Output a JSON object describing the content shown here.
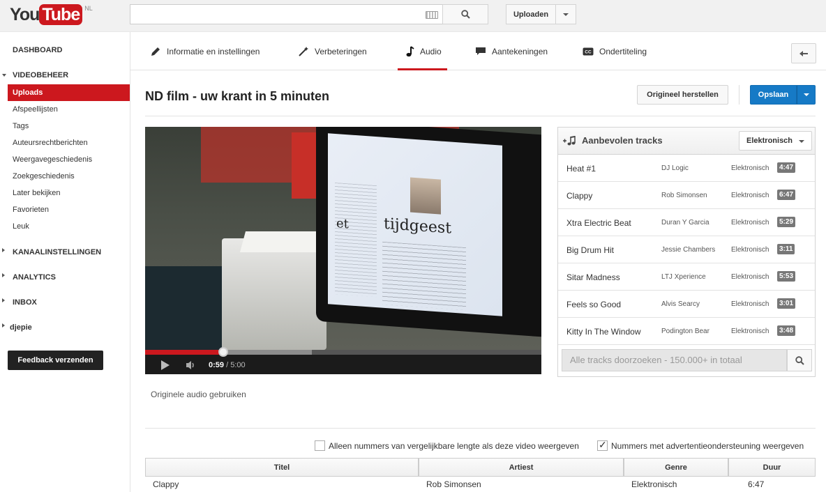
{
  "header": {
    "logo_you": "You",
    "logo_tube": "Tube",
    "logo_region": "NL",
    "search_placeholder": "",
    "upload_label": "Uploaden"
  },
  "sidebar": {
    "dashboard": "DASHBOARD",
    "videobeheer": "VIDEOBEHEER",
    "items": [
      "Uploads",
      "Afspeellijsten",
      "Tags",
      "Auteursrechtberichten",
      "Weergavegeschiedenis",
      "Zoekgeschiedenis",
      "Later bekijken",
      "Favorieten",
      "Leuk"
    ],
    "kanaal": "KANAALINSTELLINGEN",
    "analytics": "ANALYTICS",
    "inbox": "INBOX",
    "user": "djepie",
    "feedback": "Feedback verzenden"
  },
  "tabs": [
    {
      "label": "Informatie en instellingen",
      "icon": "pencil-icon"
    },
    {
      "label": "Verbeteringen",
      "icon": "magic-wand-icon"
    },
    {
      "label": "Audio",
      "icon": "music-note-icon"
    },
    {
      "label": "Aantekeningen",
      "icon": "speech-bubble-icon"
    },
    {
      "label": "Ondertiteling",
      "icon": "cc-icon"
    }
  ],
  "active_tab": "Audio",
  "editor": {
    "title": "ND film - uw krant in 5 minuten",
    "reset_label": "Origineel herstellen",
    "save_label": "Opslaan"
  },
  "video": {
    "current_time": "0:59",
    "duration": "5:00",
    "progress": 0.197,
    "buffered": 0.42,
    "screen_text": "tijdgeest",
    "screen_text2": "et"
  },
  "original_audio_label": "Originele audio gebruiken",
  "tracks_panel": {
    "title": "Aanbevolen tracks",
    "genre_selected": "Elektronisch",
    "search_placeholder": "Alle tracks doorzoeken - 150.000+ in totaal",
    "tracks": [
      {
        "title": "Heat #1",
        "artist": "DJ Logic",
        "genre": "Elektronisch",
        "duration": "4:47"
      },
      {
        "title": "Clappy",
        "artist": "Rob Simonsen",
        "genre": "Elektronisch",
        "duration": "6:47"
      },
      {
        "title": "Xtra Electric Beat",
        "artist": "Duran Y Garcia",
        "genre": "Elektronisch",
        "duration": "5:29"
      },
      {
        "title": "Big Drum Hit",
        "artist": "Jessie Chambers",
        "genre": "Elektronisch",
        "duration": "3:11"
      },
      {
        "title": "Sitar Madness",
        "artist": "LTJ Xperience",
        "genre": "Elektronisch",
        "duration": "5:53"
      },
      {
        "title": "Feels so Good",
        "artist": "Alvis Searcy",
        "genre": "Elektronisch",
        "duration": "3:01"
      },
      {
        "title": "Kitty In The Window",
        "artist": "Podington Bear",
        "genre": "Elektronisch",
        "duration": "3:48"
      }
    ]
  },
  "filters": {
    "similar_length": "Alleen nummers van vergelijkbare lengte als deze video weergeven",
    "similar_length_checked": false,
    "ad_supported": "Nummers met advertentieondersteuning weergeven",
    "ad_supported_checked": true
  },
  "table": {
    "headers": [
      "Titel",
      "Artiest",
      "Genre",
      "Duur"
    ],
    "row": {
      "title": "Clappy",
      "artist": "Rob Simonsen",
      "genre": "Elektronisch",
      "duration": "6:47"
    }
  },
  "colors": {
    "brand_red": "#cc181e",
    "save_blue": "#167ac6"
  }
}
